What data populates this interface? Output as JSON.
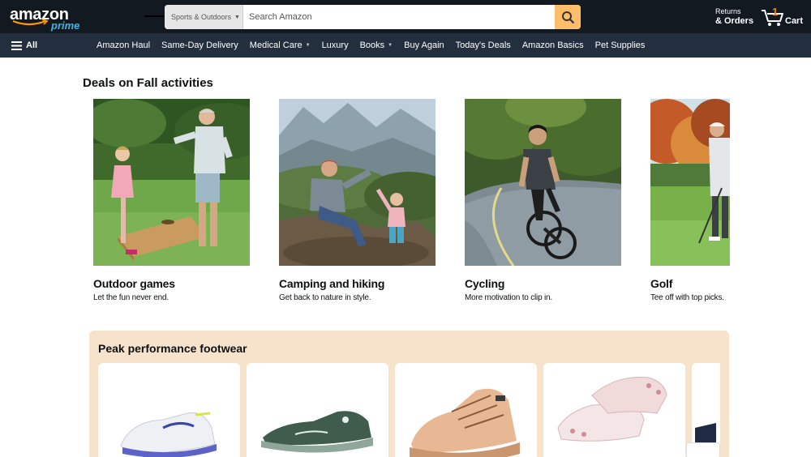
{
  "header": {
    "logo_text": "amazon",
    "logo_sub": "prime",
    "search_category": "Sports & Outdoors",
    "search_placeholder": "Search Amazon",
    "returns_line1": "Returns",
    "returns_line2": "& Orders",
    "cart_count": "1",
    "cart_label": "Cart"
  },
  "nav": {
    "all_label": "All",
    "items": [
      {
        "label": "Amazon Haul",
        "dropdown": false
      },
      {
        "label": "Same-Day Delivery",
        "dropdown": false
      },
      {
        "label": "Medical Care",
        "dropdown": true
      },
      {
        "label": "Luxury",
        "dropdown": false
      },
      {
        "label": "Books",
        "dropdown": true
      },
      {
        "label": "Buy Again",
        "dropdown": false
      },
      {
        "label": "Today's Deals",
        "dropdown": false
      },
      {
        "label": "Amazon Basics",
        "dropdown": false
      },
      {
        "label": "Pet Supplies",
        "dropdown": false
      }
    ]
  },
  "deals": {
    "title": "Deals on Fall activities",
    "cards": [
      {
        "title": "Outdoor games",
        "subtitle": "Let the fun never end.",
        "image": "outdoor-games-photo"
      },
      {
        "title": "Camping and hiking",
        "subtitle": "Get back to nature in style.",
        "image": "camping-hiking-photo"
      },
      {
        "title": "Cycling",
        "subtitle": "More motivation to clip in.",
        "image": "cycling-photo"
      },
      {
        "title": "Golf",
        "subtitle": "Tee off with top picks.",
        "image": "golf-photo"
      }
    ]
  },
  "footwear": {
    "title": "Peak performance footwear",
    "items": [
      "running-shoe-white-purple",
      "running-shoe-green",
      "hiking-shoe-tan",
      "barefoot-shoe-pink",
      "shoe-partial"
    ]
  },
  "colors": {
    "header_bg": "#131921",
    "nav_bg": "#232f3e",
    "search_button": "#febd69",
    "prime_blue": "#3fb5e4",
    "cart_count": "#f08804",
    "panel_bg": "#f7e3cc"
  }
}
